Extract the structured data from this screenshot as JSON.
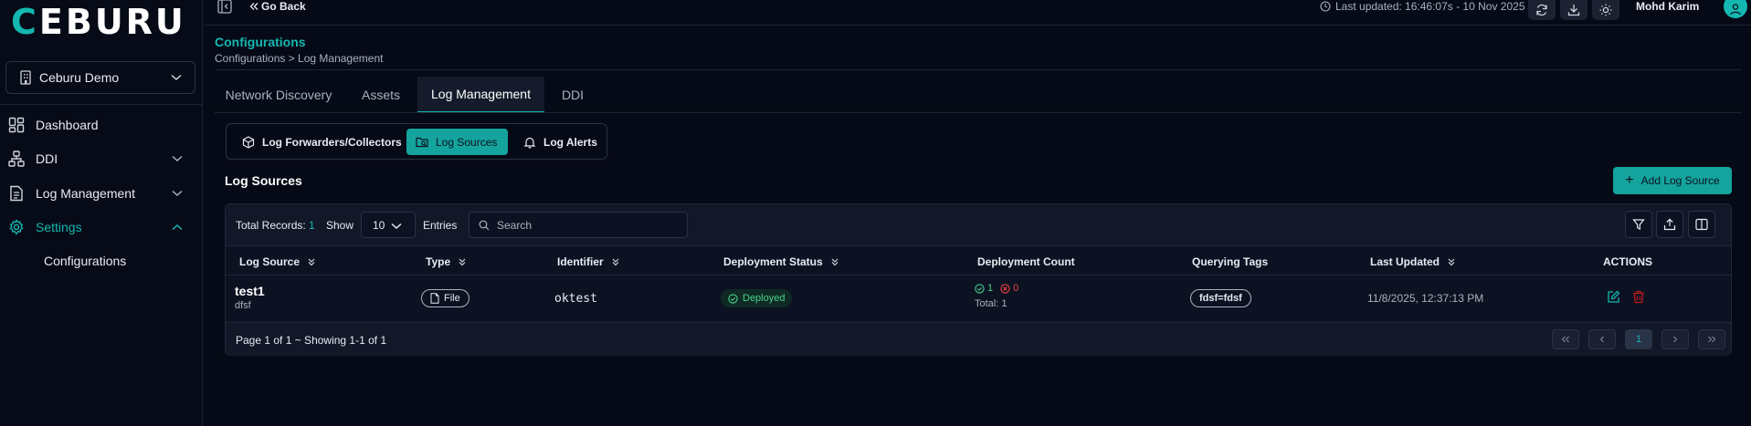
{
  "brand": {
    "logo_text": "CEBURU",
    "accent": "#14b8b0"
  },
  "sidebar": {
    "org_name": "Ceburu Demo",
    "items": [
      {
        "label": "Dashboard",
        "icon": "dashboard-icon"
      },
      {
        "label": "DDI",
        "icon": "network-icon"
      },
      {
        "label": "Log Management",
        "icon": "document-icon"
      },
      {
        "label": "Settings",
        "icon": "gear-icon"
      }
    ],
    "sub_item": "Configurations"
  },
  "topbar": {
    "go_back": "Go Back",
    "last_updated": "Last updated: 16:46:07s - 10 Nov 2025",
    "user_name": "Mohd Karim"
  },
  "page": {
    "title": "Configurations",
    "breadcrumb": "Configurations > Log Management"
  },
  "tabs": [
    "Network Discovery",
    "Assets",
    "Log Management",
    "DDI"
  ],
  "subtabs": [
    "Log Forwarders/Collectors",
    "Log Sources",
    "Log Alerts"
  ],
  "section": {
    "title": "Log Sources",
    "add_button": "Add Log Source"
  },
  "table": {
    "total_label": "Total Records:",
    "total_value": "1",
    "show_label": "Show",
    "show_value": "10",
    "entries_label": "Entries",
    "search_placeholder": "Search",
    "columns": [
      "Log Source",
      "Type",
      "Identifier",
      "Deployment Status",
      "Deployment Count",
      "Querying Tags",
      "Last Updated",
      "ACTIONS"
    ],
    "rows": [
      {
        "name": "test1",
        "description": "dfsf",
        "type": "File",
        "identifier": "oktest",
        "status": "Deployed",
        "count_ok": "1",
        "count_err": "0",
        "count_total": "Total: 1",
        "tag": "fdsf=fdsf",
        "last_updated": "11/8/2025, 12:37:13 PM"
      }
    ],
    "pagination_text": "Page 1 of 1 ~ Showing 1-1 of 1",
    "current_page": "1"
  }
}
